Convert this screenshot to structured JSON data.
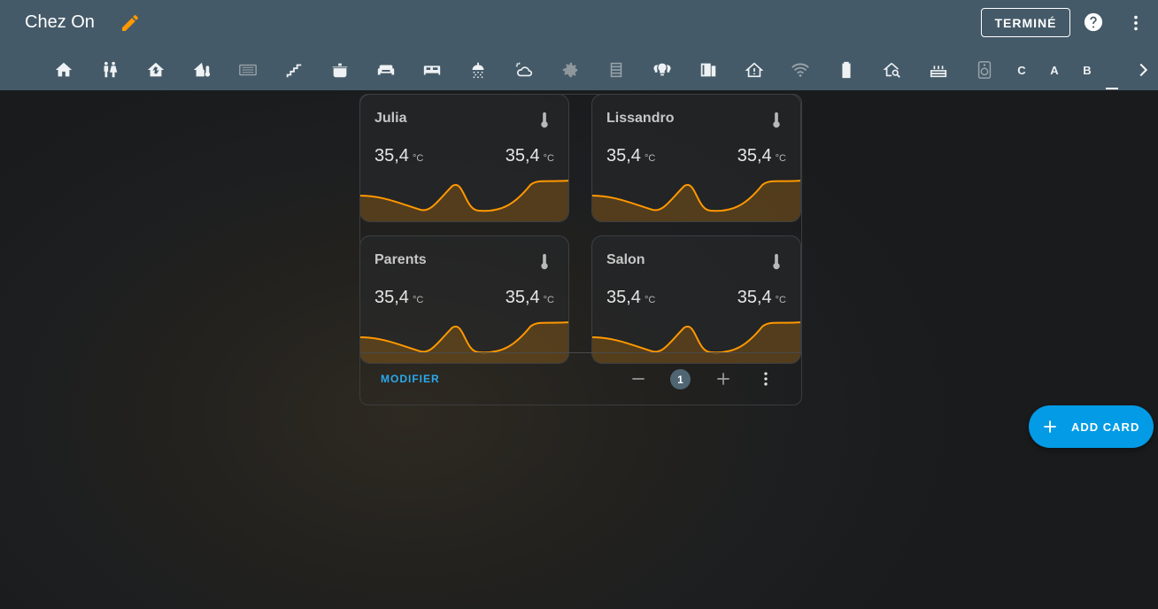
{
  "header": {
    "title": "Chez On",
    "done_label": "TERMINÉ",
    "accent": "#ff9800"
  },
  "tabs": {
    "icons": [
      "home-icon",
      "toilet-icon",
      "home-lightning-icon",
      "home-thermometer-icon",
      "radiator-display-icon",
      "stairs-icon",
      "pot-icon",
      "sofa-icon",
      "bed-icon",
      "shower-icon",
      "weather-partly-cloudy-icon",
      "gear-icon",
      "radiator-icon",
      "lightbulb-group-icon",
      "door-icon",
      "home-alert-icon",
      "wifi-icon",
      "battery-icon",
      "home-search-icon",
      "radiator-heat-icon",
      "speaker-icon"
    ],
    "letters": [
      "C",
      "A",
      "B"
    ]
  },
  "cards": [
    {
      "name": "Julia",
      "value_left": "35,4",
      "value_right": "35,4",
      "unit": "°C"
    },
    {
      "name": "Lissandro",
      "value_left": "35,4",
      "value_right": "35,4",
      "unit": "°C"
    },
    {
      "name": "Parents",
      "value_left": "35,4",
      "value_right": "35,4",
      "unit": "°C"
    },
    {
      "name": "Salon",
      "value_left": "35,4",
      "value_right": "35,4",
      "unit": "°C"
    }
  ],
  "section": {
    "modify_label": "MODIFIER",
    "count": "1"
  },
  "fab": {
    "label": "ADD CARD",
    "color": "#039be5"
  }
}
